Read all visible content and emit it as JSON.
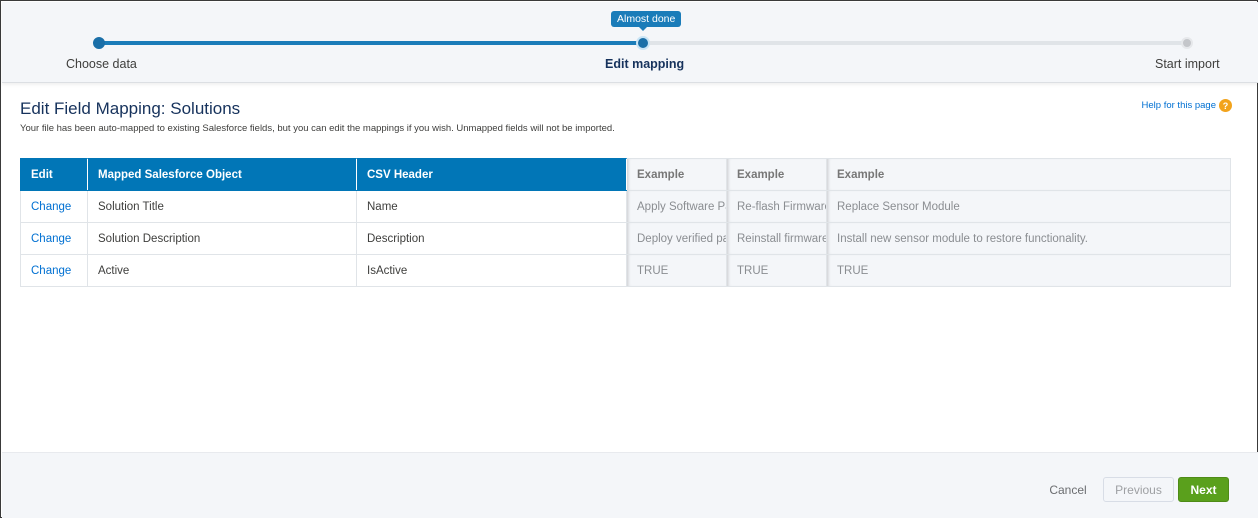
{
  "progress": {
    "steps": [
      {
        "label": "Choose data",
        "state": "done"
      },
      {
        "label": "Edit mapping",
        "state": "current"
      },
      {
        "label": "Start import",
        "state": "todo"
      }
    ],
    "tooltip": "Almost done"
  },
  "header": {
    "title": "Edit Field Mapping: Solutions",
    "subtitle": "Your file has been auto-mapped to existing Salesforce fields, but you can edit the mappings if you wish. Unmapped fields will not be imported.",
    "help_label": "Help for this page",
    "help_icon": "question-icon"
  },
  "table": {
    "columns": [
      "Edit",
      "Mapped Salesforce Object",
      "CSV Header",
      "Example",
      "Example",
      "Example"
    ],
    "rows": [
      [
        "Change",
        "Solution Title",
        "Name",
        "Apply Software Patch",
        "Re-flash Firmware",
        "Replace Sensor Module"
      ],
      [
        "Change",
        "Solution Description",
        "Description",
        "Deploy verified patch",
        "Reinstall firmware t",
        "Install new sensor module to restore functionality."
      ],
      [
        "Change",
        "Active",
        "IsActive",
        "TRUE",
        "TRUE",
        "TRUE"
      ]
    ]
  },
  "footer": {
    "cancel_label": "Cancel",
    "previous_label": "Previous",
    "next_label": "Next"
  },
  "colors": {
    "accent": "#0176b7",
    "next_button": "#5aa01c",
    "link": "#0070d2"
  }
}
